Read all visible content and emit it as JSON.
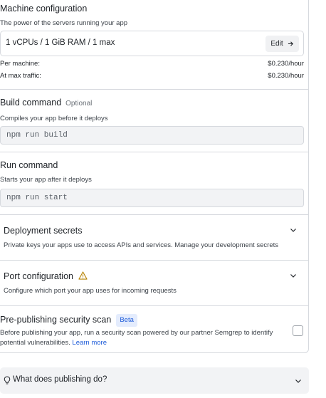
{
  "machine": {
    "title": "Machine configuration",
    "subtitle": "The power of the servers running your app",
    "value": "1 vCPUs / 1 GiB RAM / 1 max",
    "edit_label": "Edit",
    "per_machine_label": "Per machine:",
    "per_machine_cost": "$0.230/hour",
    "max_traffic_label": "At max traffic:",
    "max_traffic_cost": "$0.230/hour"
  },
  "build": {
    "title": "Build command",
    "optional": "Optional",
    "subtitle": "Compiles your app before it deploys",
    "value": "npm run build"
  },
  "run": {
    "title": "Run command",
    "subtitle": "Starts your app after it deploys",
    "value": "npm run start"
  },
  "secrets": {
    "title": "Deployment secrets",
    "description": "Private keys your apps use to access APIs and services. Manage your development secrets"
  },
  "port": {
    "title": "Port configuration",
    "description": "Configure which port your app uses for incoming requests"
  },
  "security": {
    "title": "Pre-publishing security scan",
    "badge": "Beta",
    "description_line1": "Before publishing your app, run a security scan powered by our partner Semgrep to identify",
    "description_line2": "potential vulnerabilities.",
    "learn_more": "Learn more",
    "checked": false
  },
  "faq": {
    "label": "What does publishing do?"
  },
  "icons": {
    "edit": "arrow-right-icon",
    "chevron": "chevron-down-icon",
    "warning": "warning-icon",
    "faq": "lightbulb-icon"
  },
  "colors": {
    "accent": "#1d5bd8",
    "badge_bg": "#e4ecfd",
    "warning": "#b8860b"
  }
}
